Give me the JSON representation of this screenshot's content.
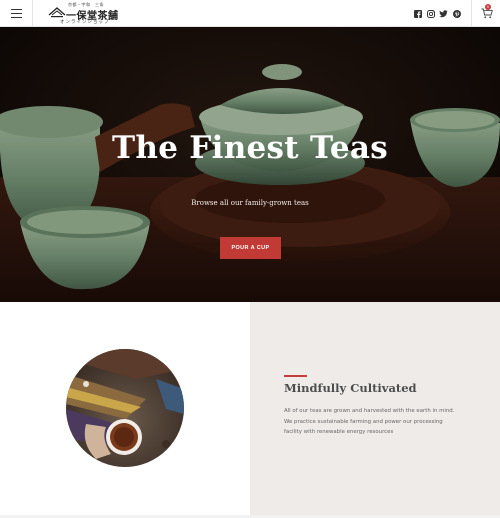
{
  "header": {
    "logo_top": "京都・宇和　三条",
    "logo_main": "一保堂茶舗",
    "logo_sub": "オンラインショップ",
    "social_icons": [
      "facebook-icon",
      "instagram-icon",
      "twitter-icon",
      "pinterest-icon"
    ],
    "cart_count": "0"
  },
  "hero": {
    "title": "The Finest Teas",
    "subtitle": "Browse all our family-grown teas",
    "button": "POUR A CUP",
    "slides": 2,
    "active_slide": 1
  },
  "feature": {
    "title": "Mindfully Cultivated",
    "body": "All of our teas are grown and harvested with the earth in mind. We practice sustainable farming and power our processing facility with renewable energy resources"
  },
  "colors": {
    "accent": "#c23a36",
    "feature_bg": "#efebe9"
  }
}
